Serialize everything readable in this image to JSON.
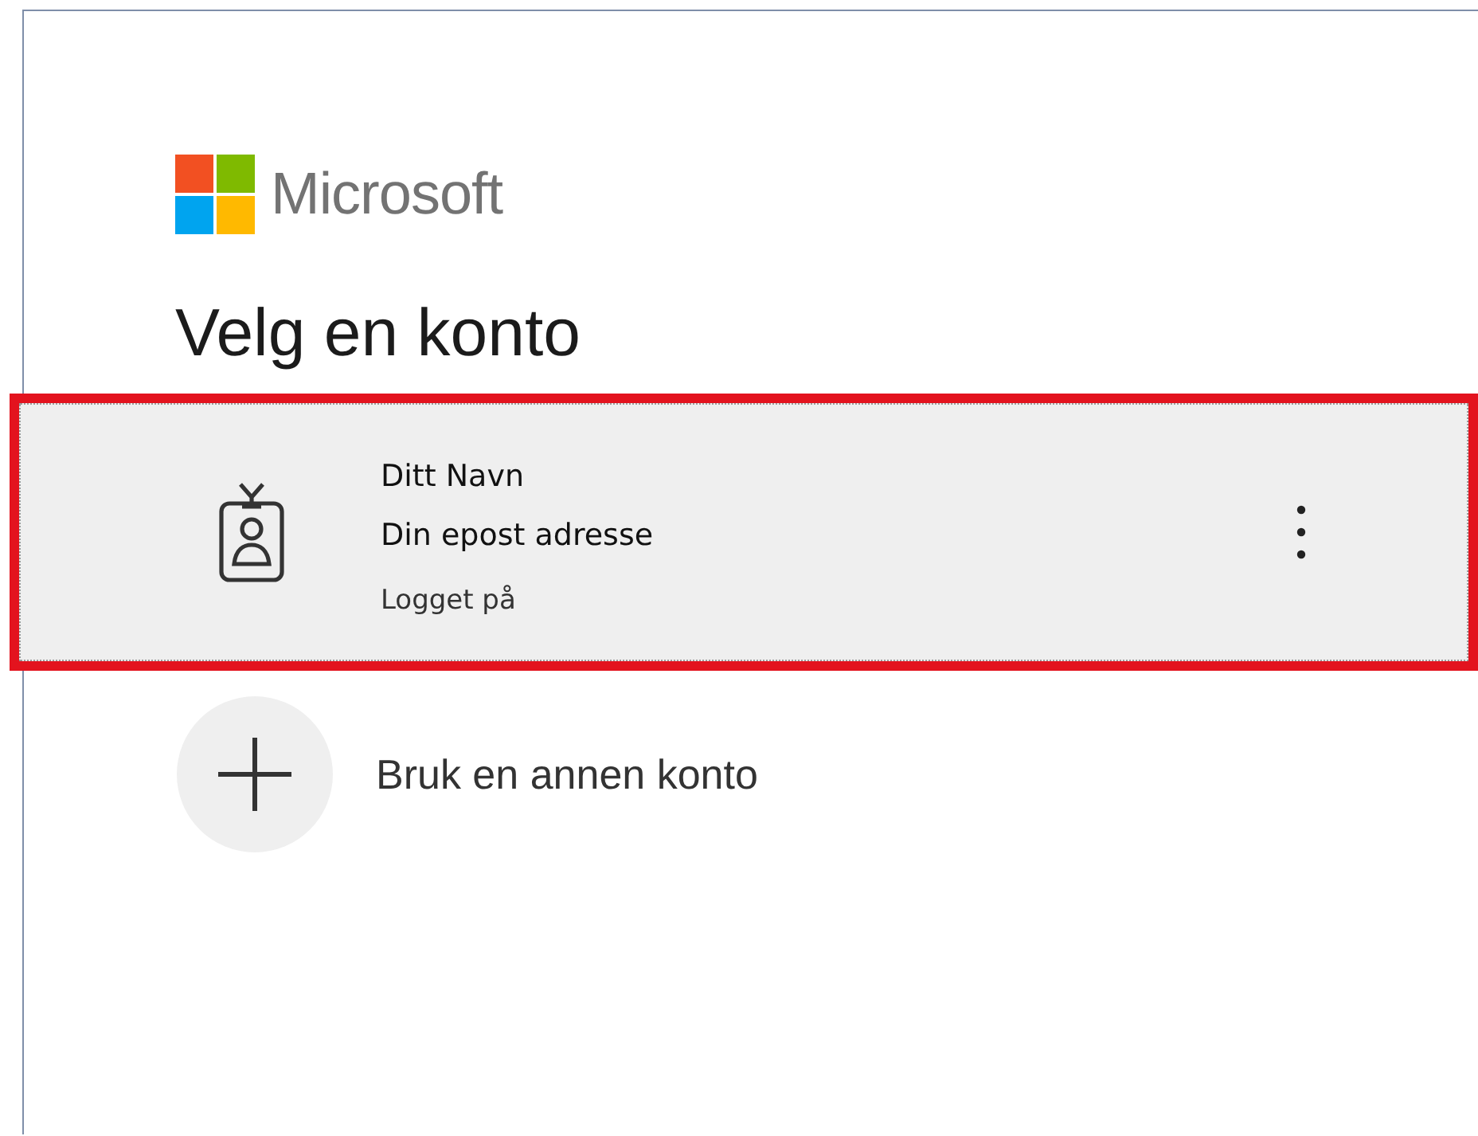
{
  "brand": {
    "name": "Microsoft"
  },
  "title": "Velg en konto",
  "accounts": [
    {
      "kind": "account",
      "name": "Ditt Navn",
      "email": "Din epost adresse",
      "status": "Logget på",
      "highlighted": true
    },
    {
      "kind": "add",
      "label": "Bruk en annen konto",
      "highlighted": false
    }
  ]
}
